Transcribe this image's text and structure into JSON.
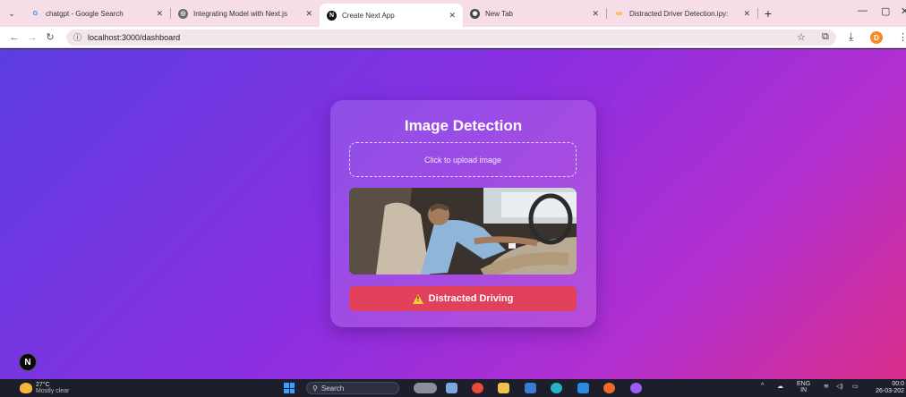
{
  "browser": {
    "tabs": [
      {
        "title": "chatgpt - Google Search",
        "icon": "google-icon",
        "color": "#4285f4",
        "glyph": "G"
      },
      {
        "title": "Integrating Model with Next.js",
        "icon": "chatgpt-icon",
        "color": "#6b6b6b",
        "glyph": "◎"
      },
      {
        "title": "Create Next App",
        "icon": "nextjs-icon",
        "color": "#111111",
        "glyph": "N"
      },
      {
        "title": "New Tab",
        "icon": "chrome-icon",
        "color": "#444444",
        "glyph": "◉"
      },
      {
        "title": "Distracted Driver Detection.ipy:",
        "icon": "colab-icon",
        "color": "#f9ab00",
        "glyph": "∞"
      }
    ],
    "active_tab": 2,
    "url": "localhost:3000/dashboard",
    "profile_initial": "D"
  },
  "page": {
    "title": "Image Detection",
    "upload_label": "Click to upload image",
    "result_label": "Distracted Driving",
    "result_color": "#e2415c",
    "nextjs_badge": "N"
  },
  "taskbar": {
    "temperature": "27°C",
    "weather": "Mostly clear",
    "search_label": "Search",
    "lang_top": "ENG",
    "lang_bottom": "IN",
    "time": "00:0",
    "date": "26-03-202"
  }
}
